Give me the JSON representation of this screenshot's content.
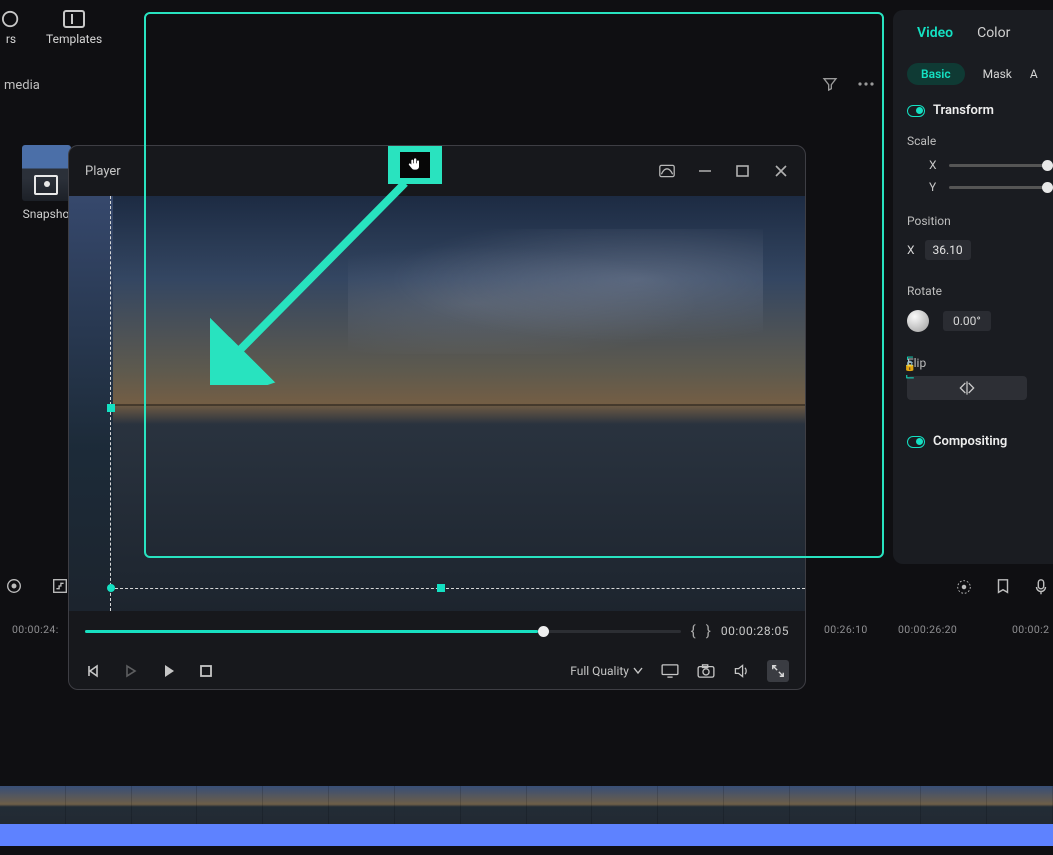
{
  "nav": {
    "stickers": "rs",
    "templates": "Templates"
  },
  "media": {
    "search": "media",
    "snapshot_label": "Snapsho"
  },
  "player": {
    "title": "Player",
    "quality": "Full Quality",
    "duration": "00:00:28:05",
    "progress_pct": 76
  },
  "panel": {
    "tabs": {
      "video": "Video",
      "color": "Color"
    },
    "subtabs": {
      "basic": "Basic",
      "mask": "Mask",
      "ai_partial": "A"
    },
    "transform": "Transform",
    "scale_label": "Scale",
    "axis_x": "X",
    "axis_y": "Y",
    "position_label": "Position",
    "position_x_axis": "X",
    "position_x_value": "36.10",
    "rotate_label": "Rotate",
    "rotate_value": "0.00°",
    "flip_label": "Flip",
    "compositing": "Compositing"
  },
  "timeline": {
    "ticks": [
      "00:00:24:",
      "00:26:10",
      "00:00:26:20",
      "00:00:2"
    ],
    "tick_positions": [
      12,
      836,
      898,
      1016
    ]
  },
  "icons": {
    "templates": "templates-icon",
    "filter": "filter-icon",
    "more": "more-icon",
    "curve": "curve-icon",
    "min": "minimize-icon",
    "max": "maximize-icon",
    "close": "close-icon",
    "prev": "step-back-icon",
    "playout": "play-outline-icon",
    "play": "play-icon",
    "stop": "stop-icon",
    "screen": "screen-icon",
    "camera": "camera-icon",
    "audio": "audio-icon",
    "expand": "expand-icon",
    "flip_h": "flip-horizontal-icon",
    "hand": "hand-tool-icon",
    "colorwheel": "color-wheel-icon",
    "marker": "marker-icon",
    "mic": "mic-icon"
  }
}
